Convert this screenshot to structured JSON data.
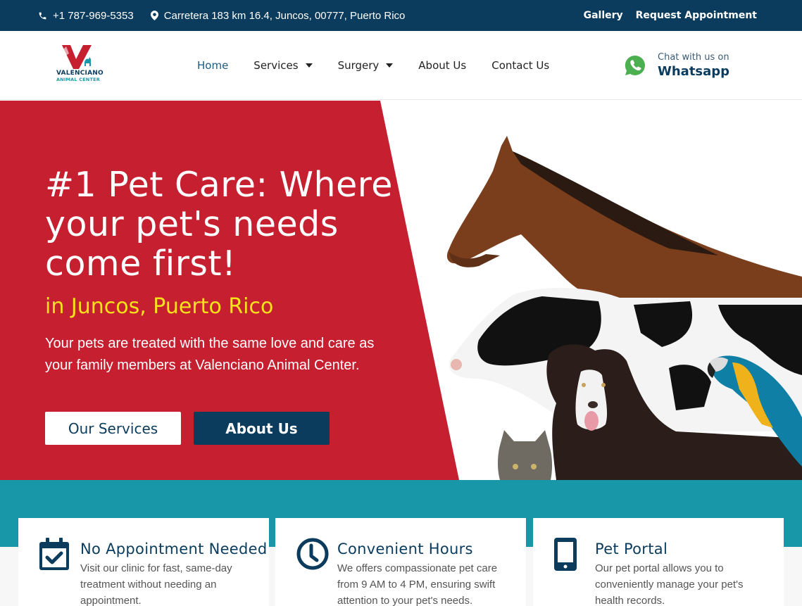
{
  "topbar": {
    "phone": "+1 787-969-5353",
    "address": "Carretera 183 km 16.4, Juncos, 00777, Puerto Rico",
    "links": [
      "Gallery",
      "Request Appointment"
    ]
  },
  "header": {
    "logo": {
      "line1": "VALENCIANO",
      "line2": "ANIMAL CENTER"
    },
    "nav": [
      {
        "label": "Home",
        "active": true,
        "dropdown": false
      },
      {
        "label": "Services",
        "active": false,
        "dropdown": true
      },
      {
        "label": "Surgery",
        "active": false,
        "dropdown": true
      },
      {
        "label": "About Us",
        "active": false,
        "dropdown": false
      },
      {
        "label": "Contact Us",
        "active": false,
        "dropdown": false
      }
    ],
    "whatsapp": {
      "small": "Chat with us on",
      "big": "Whatsapp"
    }
  },
  "hero": {
    "title": "#1 Pet Care: Where your pet's needs come first!",
    "location": "in Juncos, Puerto Rico",
    "description": "Your pets are treated with the same love and care as your family members at Valenciano Animal Center.",
    "buttons": {
      "services": "Our Services",
      "about": "About Us"
    },
    "image": {
      "icon": "animals-photo",
      "alt": "Horse, cow, dog, parrot and cat"
    }
  },
  "features": [
    {
      "icon": "calendar-check-icon",
      "title": "No Appointment Needed",
      "text": "Visit our clinic for fast, same-day treatment without needing an appointment."
    },
    {
      "icon": "clock-icon",
      "title": "Convenient Hours",
      "text": "We offers compassionate pet care from 9 AM to 4 PM, ensuring swift attention to your pet's needs."
    },
    {
      "icon": "mobile-phone-icon",
      "title": "Pet Portal",
      "text": "Our pet portal allows you to conveniently manage your pet's health records."
    }
  ],
  "colors": {
    "navy": "#0b3c5d",
    "red": "#c61f30",
    "teal": "#1897a8",
    "yellow": "#f7e11b",
    "whatsapp_green": "#4caf50"
  }
}
